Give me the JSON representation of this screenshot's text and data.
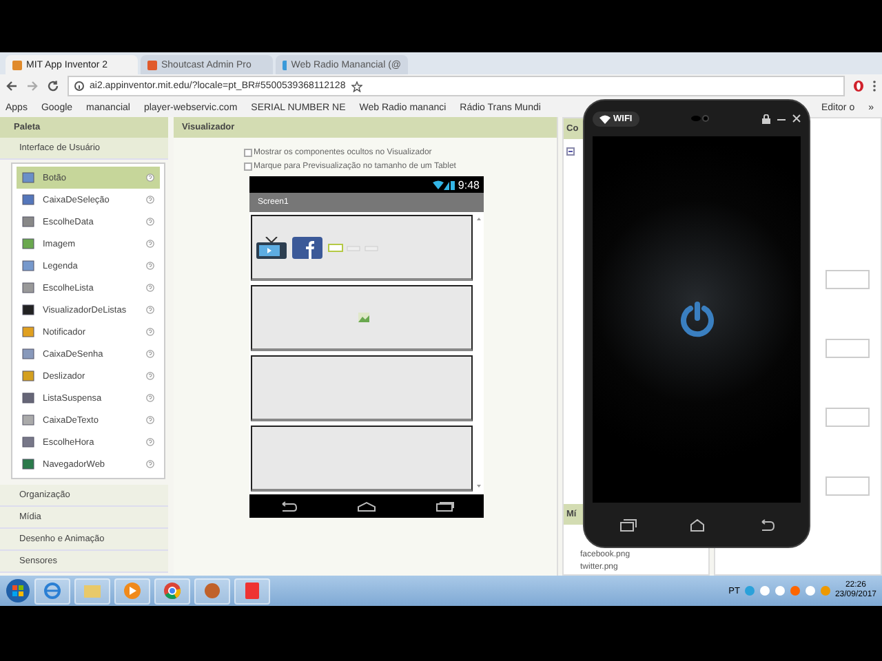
{
  "browser": {
    "tabs": [
      {
        "title": "MIT App Inventor 2",
        "selected": true
      },
      {
        "title": "Shoutcast Admin Pro",
        "selected": false
      },
      {
        "title": "Web Radio Manancial (@",
        "selected": false
      }
    ],
    "address": "ai2.appinventor.mit.edu/?locale=pt_BR#5500539368112128",
    "bookmarks": [
      "Apps",
      "Google",
      "manancial",
      "player-webservic.com",
      "SERIAL NUMBER NE",
      "Web Radio mananci",
      "Rádio Trans Mundi",
      "Editor o"
    ],
    "more_bookmarks": "»"
  },
  "palette": {
    "title": "Paleta",
    "sections": [
      {
        "label": "Interface de Usuário",
        "expanded": true,
        "items": [
          {
            "label": "Botão",
            "selected": true
          },
          {
            "label": "CaixaDeSeleção",
            "selected": false
          },
          {
            "label": "EscolheData",
            "selected": false
          },
          {
            "label": "Imagem",
            "selected": false
          },
          {
            "label": "Legenda",
            "selected": false
          },
          {
            "label": "EscolheLista",
            "selected": false
          },
          {
            "label": "VisualizadorDeListas",
            "selected": false
          },
          {
            "label": "Notificador",
            "selected": false
          },
          {
            "label": "CaixaDeSenha",
            "selected": false
          },
          {
            "label": "Deslizador",
            "selected": false
          },
          {
            "label": "ListaSuspensa",
            "selected": false
          },
          {
            "label": "CaixaDeTexto",
            "selected": false
          },
          {
            "label": "EscolheHora",
            "selected": false
          },
          {
            "label": "NavegadorWeb",
            "selected": false
          }
        ]
      },
      {
        "label": "Organização",
        "expanded": false
      },
      {
        "label": "Mídia",
        "expanded": false
      },
      {
        "label": "Desenho e Animação",
        "expanded": false
      },
      {
        "label": "Sensores",
        "expanded": false
      }
    ]
  },
  "viewer": {
    "title": "Visualizador",
    "options": [
      {
        "label": "Mostrar os componentes ocultos no Visualizador",
        "checked": false
      },
      {
        "label": "Marque para Previsualização no tamanho de um Tablet",
        "checked": false
      }
    ],
    "phone": {
      "time": "9:48",
      "screen_title": "Screen1"
    }
  },
  "components": {
    "title": "Co",
    "media_title": "Mí",
    "media": [
      "facebook.png",
      "twitter.png"
    ]
  },
  "emulator": {
    "wifi": "WIFI"
  },
  "taskbar": {
    "language": "PT",
    "time": "22:26",
    "date": "23/09/2017"
  }
}
